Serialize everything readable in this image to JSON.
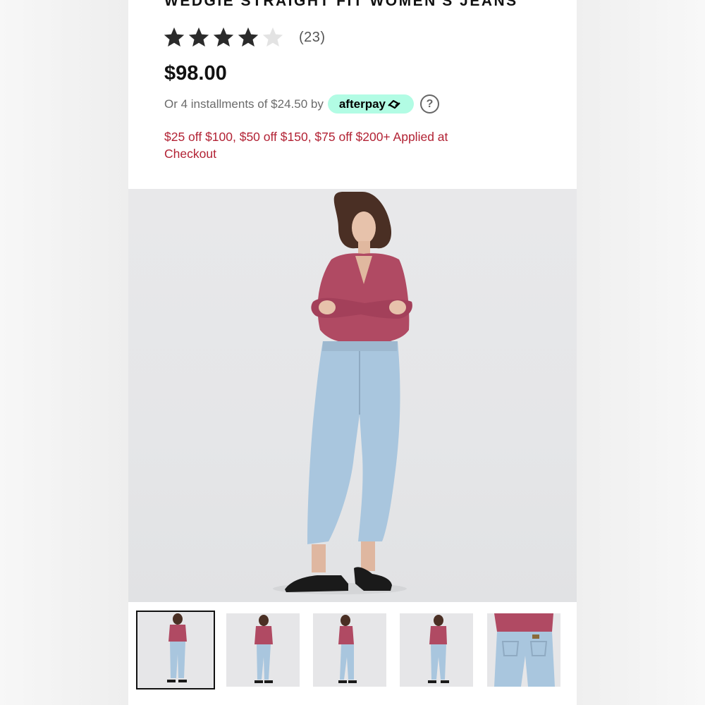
{
  "product": {
    "title": "WEDGIE STRAIGHT FIT WOMEN'S JEANS",
    "rating": 4,
    "rating_max": 5,
    "review_count": "(23)",
    "price": "$98.00",
    "installments_text": "Or 4 installments of $24.50 by",
    "afterpay_label": "afterpay",
    "help_symbol": "?",
    "promo_line1": "$25 off $100, $50 off $150, $75 off $200+ Applied at",
    "promo_line2": "Checkout"
  },
  "colors": {
    "promo": "#b22234",
    "afterpay_badge": "#b2fce4",
    "star_filled": "#2b2b2b",
    "star_empty": "#e3e3e3",
    "shirt": "#b04a63",
    "jeans": "#a9c6de"
  },
  "icons": [
    "star-icon",
    "afterpay-arrows-icon",
    "help-icon"
  ],
  "thumbnails": [
    "front",
    "front-side",
    "side",
    "back",
    "back-closeup"
  ],
  "selected_thumbnail": 0
}
